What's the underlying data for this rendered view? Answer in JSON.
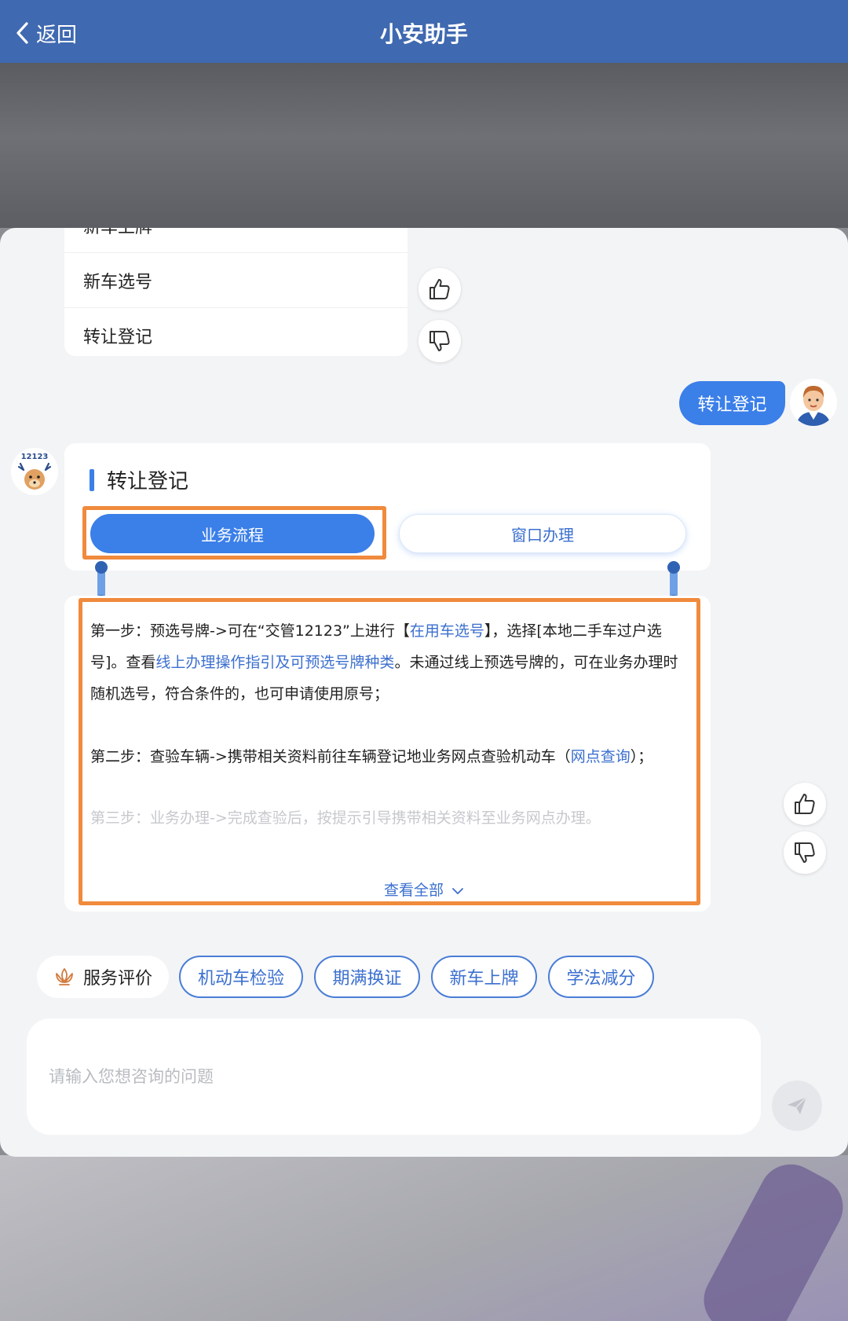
{
  "header": {
    "back_label": "返回",
    "title": "小安助手"
  },
  "menu": {
    "items": [
      "新车上牌",
      "新车选号",
      "转让登记"
    ]
  },
  "user_message": "转让登记",
  "bot_logo_text": "12123",
  "answer": {
    "title": "转让登记",
    "tabs": [
      "业务流程",
      "窗口办理"
    ],
    "step1": {
      "a": "第一步：预选号牌->可在“交管12123”上进行【",
      "link1": "在用车选号",
      "b": "】，选择[本地二手车过户选号]。查看",
      "link2": "线上办理操作指引及可预选号牌种类",
      "c": "。未通过线上预选号牌的，可在业务办理时随机选号，符合条件的，也可申请使用原号；"
    },
    "step2": {
      "a": "第二步：查验车辆->携带相关资料前往车辆登记地业务网点查验机动车（",
      "link": "网点查询",
      "b": "）；"
    },
    "step3": "第三步：业务办理->完成查验后，按提示引导携带相关资料至业务网点办理。",
    "view_all": "查看全部"
  },
  "quick": {
    "rating": "服务评价",
    "pills": [
      "机动车检验",
      "期满换证",
      "新车上牌",
      "学法减分"
    ]
  },
  "input": {
    "placeholder": "请输入您想咨询的问题",
    "value": ""
  },
  "colors": {
    "header": "#3f69b0",
    "accent": "#3b7fe8",
    "highlight": "#f08a3c"
  }
}
